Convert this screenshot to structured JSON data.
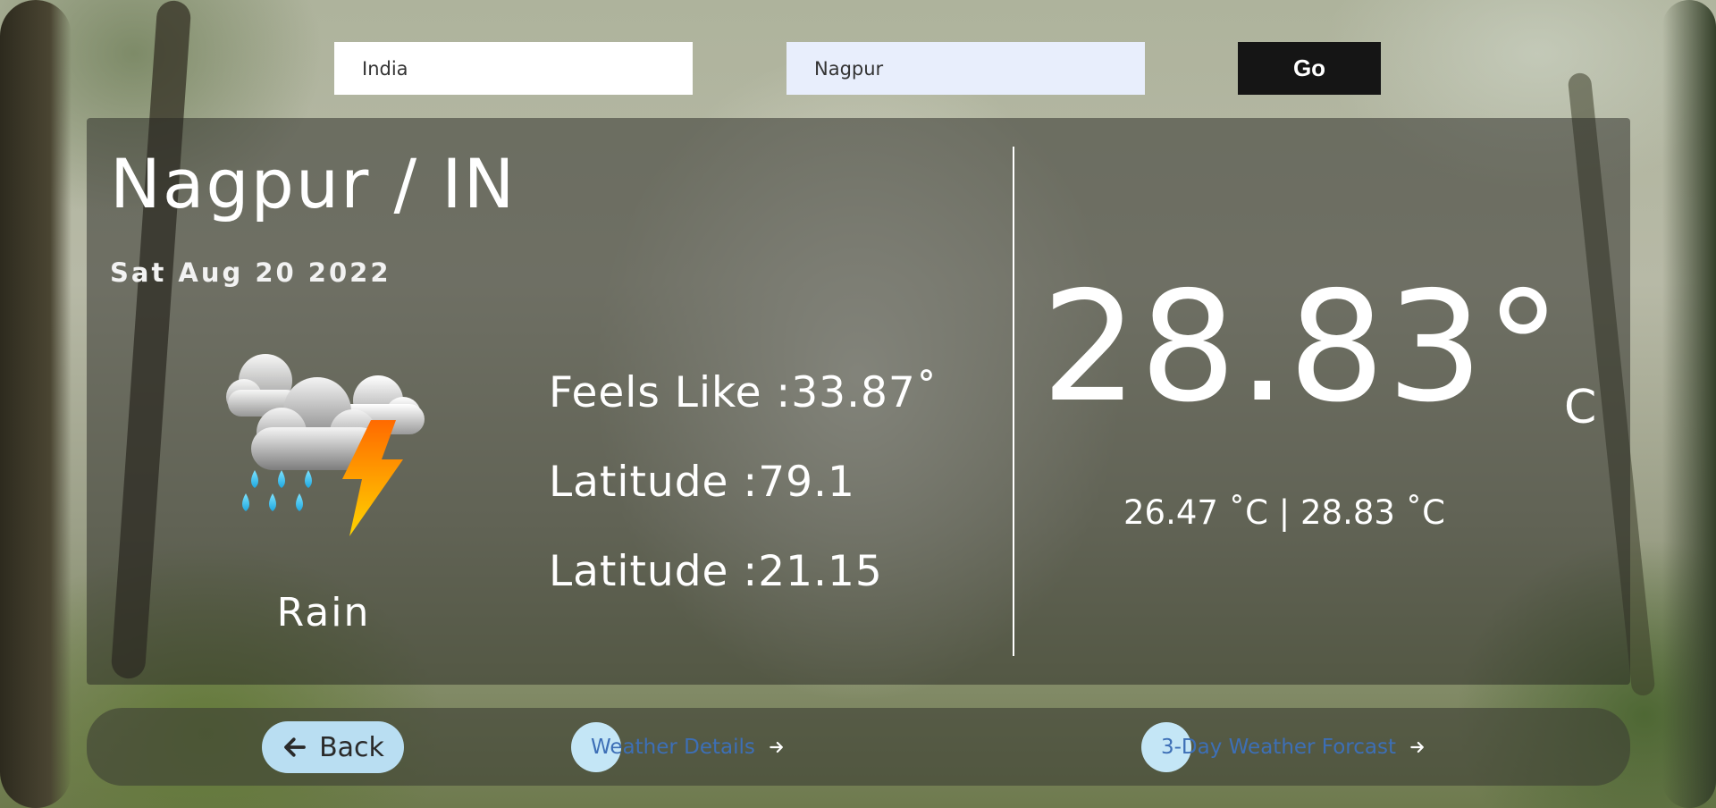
{
  "search": {
    "country_value": "India",
    "city_value": "Nagpur",
    "go_label": "Go"
  },
  "weather": {
    "city_title": "Nagpur / IN",
    "date": "Sat Aug 20 2022",
    "condition": "Rain",
    "icon": "thunderstorm-rain-icon",
    "feels_like": "Feels Like :33.87˚",
    "longitude_line": "Latitude :79.1",
    "latitude_line": "Latitude :21.15",
    "temperature": "28.83°",
    "temperature_unit": "C",
    "temp_range": "26.47 ˚C | 28.83 ˚C"
  },
  "nav": {
    "back_label": "Back",
    "details_label": "Weather Details",
    "forecast_label": "3-Day Weather Forcast"
  },
  "colors": {
    "go_button": "#151515",
    "back_button": "#b9def2",
    "link_text": "#3d6fb6",
    "city_input_bg": "#e8eefc"
  }
}
